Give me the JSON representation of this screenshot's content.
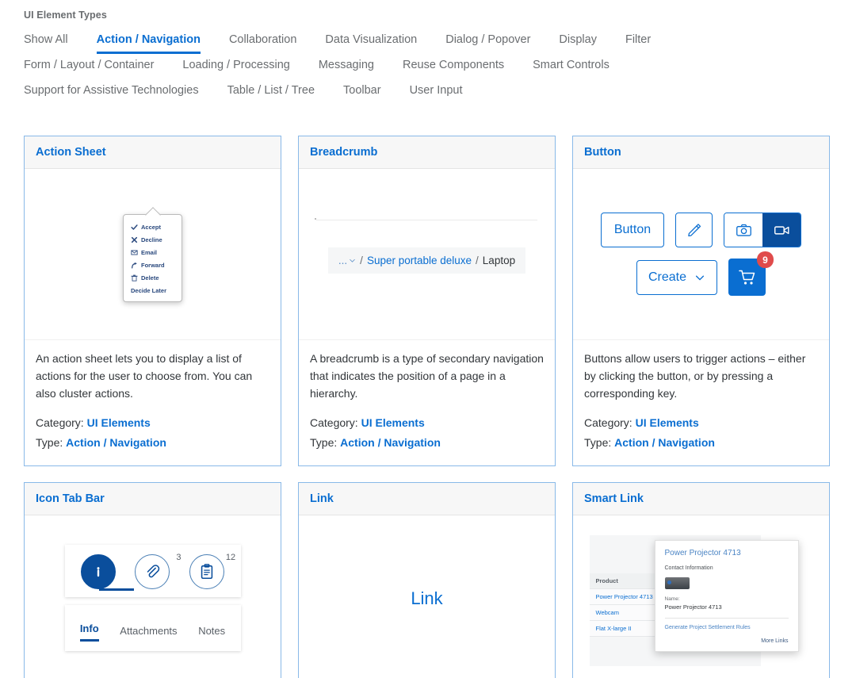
{
  "header": {
    "title": "UI Element Types",
    "tab_rows": [
      [
        {
          "label": "Show All",
          "active": false
        },
        {
          "label": "Action / Navigation",
          "active": true
        },
        {
          "label": "Collaboration",
          "active": false
        },
        {
          "label": "Data Visualization",
          "active": false
        },
        {
          "label": "Dialog / Popover",
          "active": false
        },
        {
          "label": "Display",
          "active": false
        },
        {
          "label": "Filter",
          "active": false
        }
      ],
      [
        {
          "label": "Form / Layout / Container",
          "active": false
        },
        {
          "label": "Loading / Processing",
          "active": false
        },
        {
          "label": "Messaging",
          "active": false
        },
        {
          "label": "Reuse Components",
          "active": false
        },
        {
          "label": "Smart Controls",
          "active": false
        }
      ],
      [
        {
          "label": "Support for Assistive Technologies",
          "active": false
        },
        {
          "label": "Table / List / Tree",
          "active": false
        },
        {
          "label": "Toolbar",
          "active": false
        },
        {
          "label": "User Input",
          "active": false
        }
      ]
    ]
  },
  "labels": {
    "category_label": "Category:",
    "type_label": "Type:"
  },
  "colors": {
    "accent": "#0a6ed1",
    "accent_dark": "#0a4e9c",
    "badge_red": "#e04b4b",
    "card_border": "#89b9e8",
    "header_bg": "#f7f7f7",
    "muted_text": "#6a6d70"
  },
  "cards": {
    "action_sheet": {
      "title": "Action Sheet",
      "description": "An action sheet lets you to display a list of actions for the user to choose from. You can also cluster actions.",
      "category": "UI Elements",
      "type": "Action / Navigation",
      "items": [
        {
          "label": "Accept",
          "icon": "check-icon"
        },
        {
          "label": "Decline",
          "icon": "close-icon"
        },
        {
          "label": "Email",
          "icon": "envelope-icon"
        },
        {
          "label": "Forward",
          "icon": "forward-arrow-icon"
        },
        {
          "label": "Delete",
          "icon": "trash-icon"
        },
        {
          "label": "Decide Later",
          "icon": ""
        }
      ]
    },
    "breadcrumb": {
      "title": "Breadcrumb",
      "description": "A breadcrumb is a type of secondary navigation that indicates the position of a page in a hierarchy.",
      "category": "UI Elements",
      "type": "Action / Navigation",
      "trail": {
        "ellipsis": "...",
        "separator": "/",
        "link": "Super portable deluxe",
        "current": "Laptop"
      }
    },
    "button": {
      "title": "Button",
      "description": "Buttons allow users to trigger actions – either by clicking the button, or by pressing a corresponding key.",
      "category": "UI Elements",
      "type": "Action / Navigation",
      "samples": {
        "plain_button": "Button",
        "edit_icon": "pencil-icon",
        "segment_camera": "camera-icon",
        "segment_video": "video-camera-icon",
        "create_button": "Create",
        "cart_icon": "shopping-cart-icon",
        "cart_badge": "9"
      }
    },
    "icon_tab_bar": {
      "title": "Icon Tab Bar",
      "description": "",
      "icon_tabs": [
        {
          "icon": "info-icon",
          "count": "",
          "selected": true
        },
        {
          "icon": "paperclip-icon",
          "count": "3",
          "selected": false
        },
        {
          "icon": "clipboard-icon",
          "count": "12",
          "selected": false
        }
      ],
      "text_tabs": [
        {
          "label": "Info",
          "selected": true
        },
        {
          "label": "Attachments",
          "selected": false
        },
        {
          "label": "Notes",
          "selected": false
        }
      ]
    },
    "link": {
      "title": "Link",
      "sample_link": "Link"
    },
    "smart_link": {
      "title": "Smart Link",
      "table": {
        "column_header": "Product",
        "rows": [
          "Power Projector 4713",
          "Webcam",
          "Flat X-large II"
        ]
      },
      "popup": {
        "title": "Power Projector 4713",
        "subtitle": "Contact Information",
        "name_label": "Name:",
        "name_value": "Power Projector 4713",
        "action": "Generate Project Settlement Rules",
        "more": "More Links"
      }
    }
  }
}
